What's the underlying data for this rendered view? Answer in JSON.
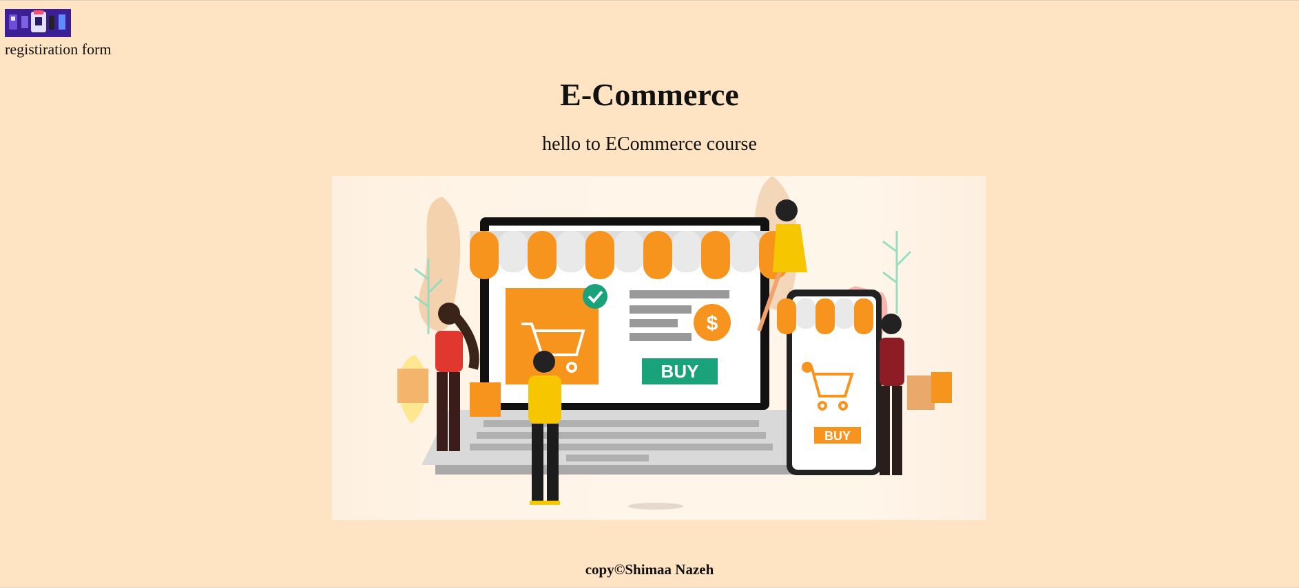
{
  "nav": {
    "logo_icon": "shop-banner-icon",
    "registration_link": "registiration form"
  },
  "main": {
    "title": "E-Commerce",
    "subtitle": "hello to ECommerce course",
    "hero": {
      "icon": "ecommerce-illustration",
      "buy_label_laptop": "BUY",
      "buy_label_phone": "BUY",
      "currency_symbol": "$"
    }
  },
  "footer": {
    "text": "copy©Shimaa Nazeh"
  },
  "colors": {
    "background": "#ffe4c4",
    "accent_orange": "#f7941d",
    "accent_green": "#1aa37a"
  }
}
